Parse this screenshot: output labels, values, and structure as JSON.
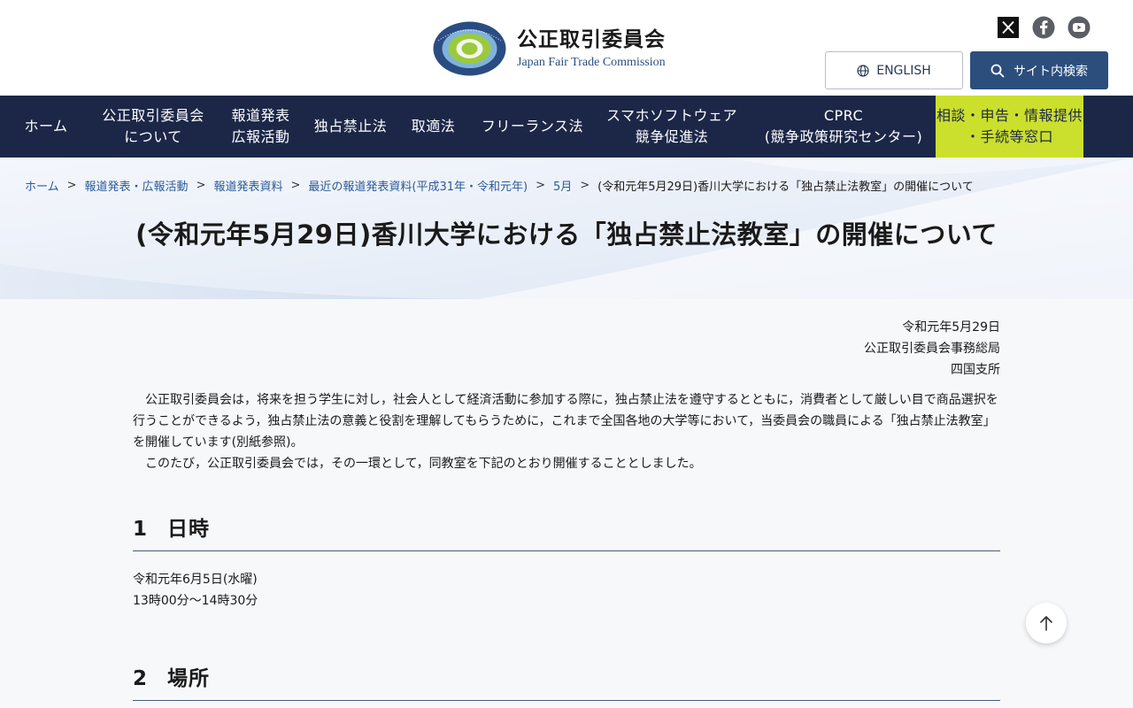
{
  "header": {
    "logo_ja": "公正取引委員会",
    "logo_en": "Japan Fair Trade Commission",
    "english_label": "ENGLISH",
    "search_label": "サイト内検索",
    "social": [
      "x-icon",
      "facebook-icon",
      "youtube-icon"
    ]
  },
  "nav": {
    "items": [
      {
        "label": "ホーム"
      },
      {
        "label": "公正取引委員会\nについて"
      },
      {
        "label": "報道発表\n広報活動"
      },
      {
        "label": "独占禁止法"
      },
      {
        "label": "取適法"
      },
      {
        "label": "フリーランス法"
      },
      {
        "label": "スマホソフトウェア\n競争促進法"
      },
      {
        "label": "CPRC\n(競争政策研究センター)"
      },
      {
        "label": "相談・申告・情報提供\n・手続等窓口"
      }
    ]
  },
  "breadcrumb": {
    "items": [
      "ホーム",
      "報道発表・広報活動",
      "報道発表資料",
      "最近の報道発表資料(平成31年・令和元年)",
      "5月"
    ],
    "current": "(令和元年5月29日)香川大学における「独占禁止法教室」の開催について",
    "separator": ">"
  },
  "page": {
    "title": "(令和元年5月29日)香川大学における「独占禁止法教室」の開催について"
  },
  "meta": {
    "date": "令和元年5月29日",
    "org": "公正取引委員会事務総局",
    "branch": "四国支所"
  },
  "body": {
    "para1": "公正取引委員会は，将来を担う学生に対し，社会人として経済活動に参加する際に，独占禁止法を遵守するとともに，消費者として厳しい目で商品選択を行うことができるよう，独占禁止法の意義と役割を理解してもらうために，これまで全国各地の大学等において，当委員会の職員による「独占禁止法教室」を開催しています(別紙参照)。",
    "para2": "このたび，公正取引委員会では，その一環として，同教室を下記のとおり開催することとしました。"
  },
  "sections": [
    {
      "num": "1",
      "title": "日時",
      "lines": [
        "令和元年6月5日(水曜)",
        "13時00分〜14時30分"
      ]
    },
    {
      "num": "2",
      "title": "場所"
    }
  ],
  "colors": {
    "nav_bg": "#1c2748",
    "accent": "#cbdf2d",
    "brand_blue": "#2c4e7c",
    "link": "#2b5a9a"
  }
}
